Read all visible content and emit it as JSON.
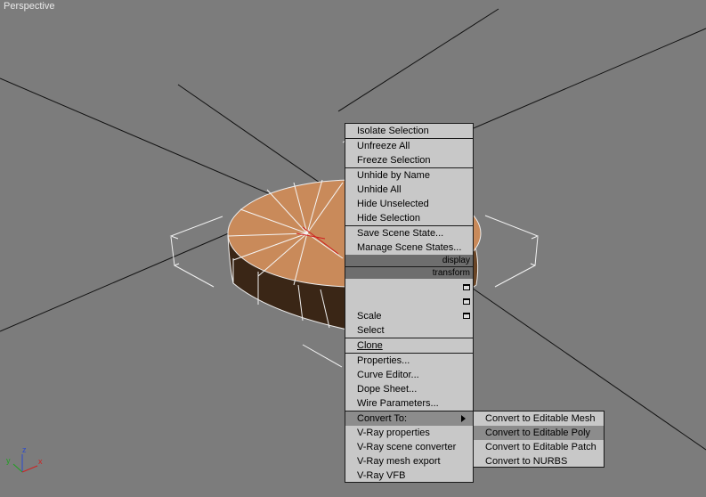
{
  "viewport": {
    "label": "Perspective",
    "axis_labels": {
      "x": "x",
      "y": "y",
      "z": "z"
    }
  },
  "colors": {
    "background": "#7c7c7c",
    "grid": "#111111",
    "object_top": "#c98a5a",
    "menu_bg": "#c8c8c8",
    "menu_highlight": "#8c8c8c",
    "menu_header": "#6e6e6e"
  },
  "quad_menu": {
    "isolate_selection": "Isolate Selection",
    "unfreeze_all": "Unfreeze All",
    "freeze_selection": "Freeze Selection",
    "unhide_by_name": "Unhide by Name",
    "unhide_all": "Unhide All",
    "hide_unselected": "Hide Unselected",
    "hide_selection": "Hide Selection",
    "save_scene_state": "Save Scene State...",
    "manage_scene_states": "Manage Scene States...",
    "display_header": "display",
    "transform_header": "transform",
    "scale": "Scale",
    "select": "Select",
    "clone": "Clone",
    "properties": "Properties...",
    "curve_editor": "Curve Editor...",
    "dope_sheet": "Dope Sheet...",
    "wire_parameters": "Wire Parameters...",
    "convert_to": "Convert To:",
    "vray_properties": "V-Ray properties",
    "vray_scene_converter": "V-Ray scene converter",
    "vray_mesh_export": "V-Ray mesh export",
    "vray_vfb": "V-Ray VFB"
  },
  "submenu": {
    "items": [
      "Convert to Editable Mesh",
      "Convert to Editable Poly",
      "Convert to Editable Patch",
      "Convert to NURBS"
    ],
    "highlighted_index": 1
  }
}
